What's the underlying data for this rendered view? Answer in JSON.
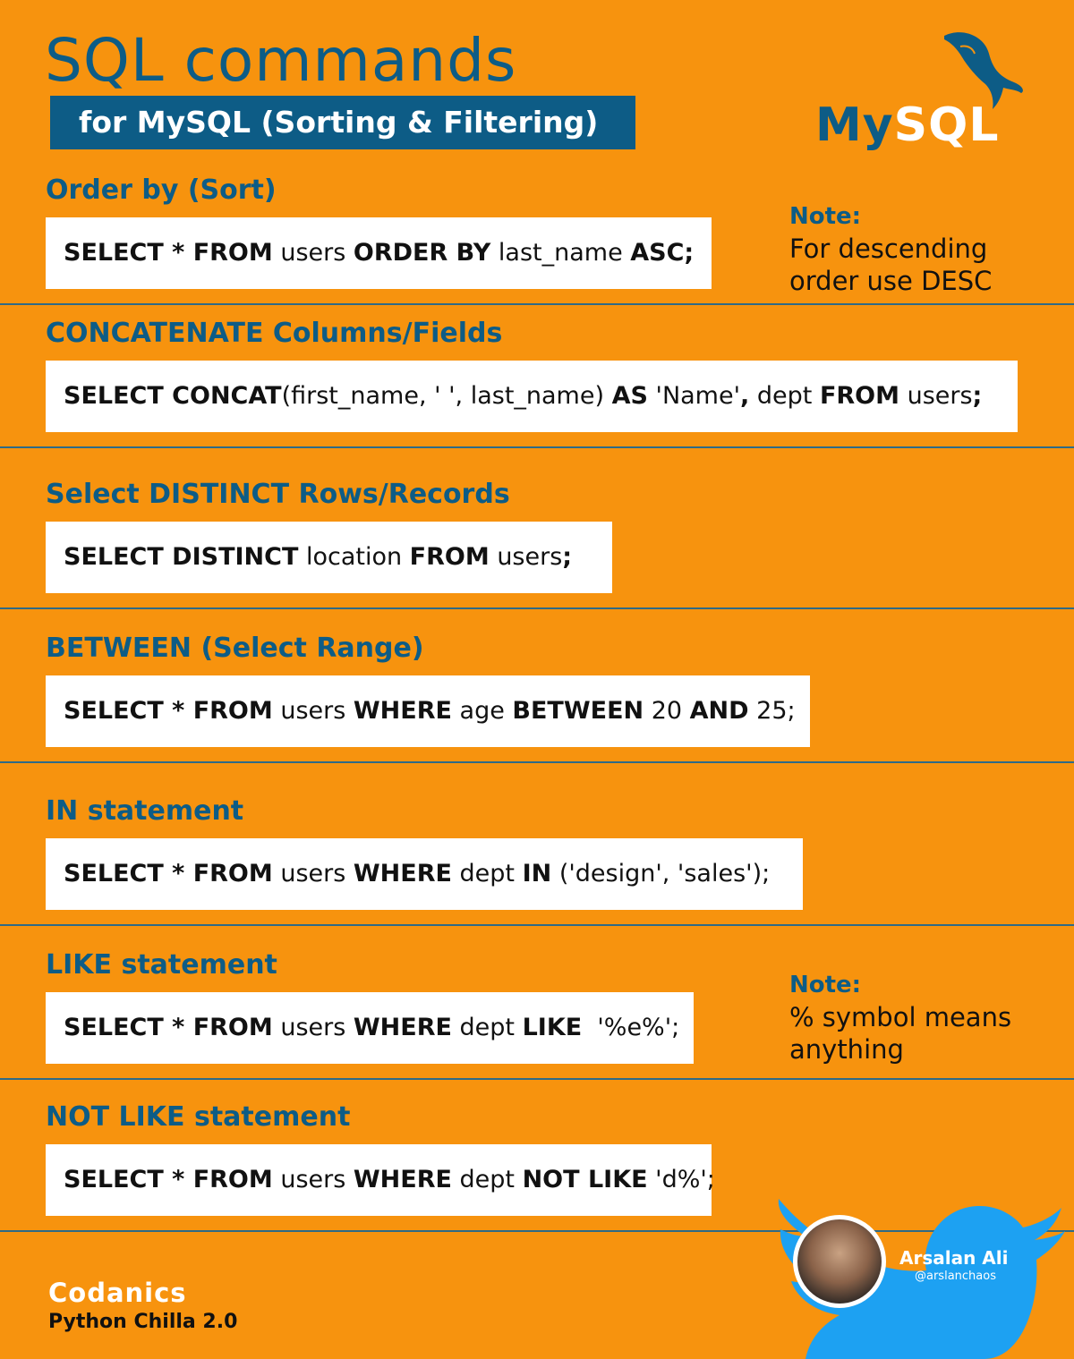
{
  "header": {
    "title": "SQL commands",
    "subtitle": "for MySQL (Sorting & Filtering)",
    "logo_text_my": "My",
    "logo_text_sql": "SQL"
  },
  "sections": [
    {
      "title": "Order by (Sort)",
      "code": [
        {
          "t": "SELECT * FROM",
          "k": true
        },
        {
          "t": " users ",
          "k": false
        },
        {
          "t": "ORDER BY",
          "k": true
        },
        {
          "t": " last_name ",
          "k": false
        },
        {
          "t": "ASC;",
          "k": true
        }
      ]
    },
    {
      "title": "CONCATENATE Columns/Fields",
      "code": [
        {
          "t": "SELECT CONCAT",
          "k": true
        },
        {
          "t": "(first_name, ' ', last_name) ",
          "k": false
        },
        {
          "t": "AS",
          "k": true
        },
        {
          "t": " 'Name'",
          "k": false
        },
        {
          "t": ",",
          "k": true
        },
        {
          "t": " dept ",
          "k": false
        },
        {
          "t": "FROM",
          "k": true
        },
        {
          "t": " users",
          "k": false
        },
        {
          "t": ";",
          "k": true
        }
      ]
    },
    {
      "title": "Select DISTINCT Rows/Records",
      "code": [
        {
          "t": "SELECT DISTINCT",
          "k": true
        },
        {
          "t": " location ",
          "k": false
        },
        {
          "t": "FROM",
          "k": true
        },
        {
          "t": " users",
          "k": false
        },
        {
          "t": ";",
          "k": true
        }
      ]
    },
    {
      "title": "BETWEEN (Select Range)",
      "code": [
        {
          "t": "SELECT * FROM",
          "k": true
        },
        {
          "t": " users ",
          "k": false
        },
        {
          "t": "WHERE",
          "k": true
        },
        {
          "t": " age ",
          "k": false
        },
        {
          "t": "BETWEEN",
          "k": true
        },
        {
          "t": " 20 ",
          "k": false
        },
        {
          "t": "AND",
          "k": true
        },
        {
          "t": " 25;",
          "k": false
        }
      ]
    },
    {
      "title": "IN statement",
      "code": [
        {
          "t": "SELECT * FROM",
          "k": true
        },
        {
          "t": " users ",
          "k": false
        },
        {
          "t": "WHERE",
          "k": true
        },
        {
          "t": " dept ",
          "k": false
        },
        {
          "t": "IN",
          "k": true
        },
        {
          "t": " ('design', 'sales');",
          "k": false
        }
      ]
    },
    {
      "title": "LIKE statement",
      "code": [
        {
          "t": "SELECT * FROM",
          "k": true
        },
        {
          "t": " users ",
          "k": false
        },
        {
          "t": "WHERE",
          "k": true
        },
        {
          "t": " dept ",
          "k": false
        },
        {
          "t": "LIKE",
          "k": true
        },
        {
          "t": "  '%e%';",
          "k": false
        }
      ]
    },
    {
      "title": "NOT LIKE statement",
      "code": [
        {
          "t": "SELECT * FROM",
          "k": true
        },
        {
          "t": " users ",
          "k": false
        },
        {
          "t": "WHERE",
          "k": true
        },
        {
          "t": " dept ",
          "k": false
        },
        {
          "t": "NOT LIKE",
          "k": true
        },
        {
          "t": " 'd%';",
          "k": false
        }
      ]
    }
  ],
  "notes": [
    {
      "label": "Note:",
      "line1": "For descending",
      "line2": "order use DESC"
    },
    {
      "label": "Note:",
      "line1": "% symbol means",
      "line2": "anything"
    }
  ],
  "footer": {
    "brand": "Codanics",
    "sub": "Python Chilla 2.0",
    "author_name": "Arsalan Ali",
    "author_handle": "@arslanchaos"
  },
  "colors": {
    "background": "#f7930e",
    "accent": "#0d5c86",
    "twitter": "#1da1f2"
  }
}
